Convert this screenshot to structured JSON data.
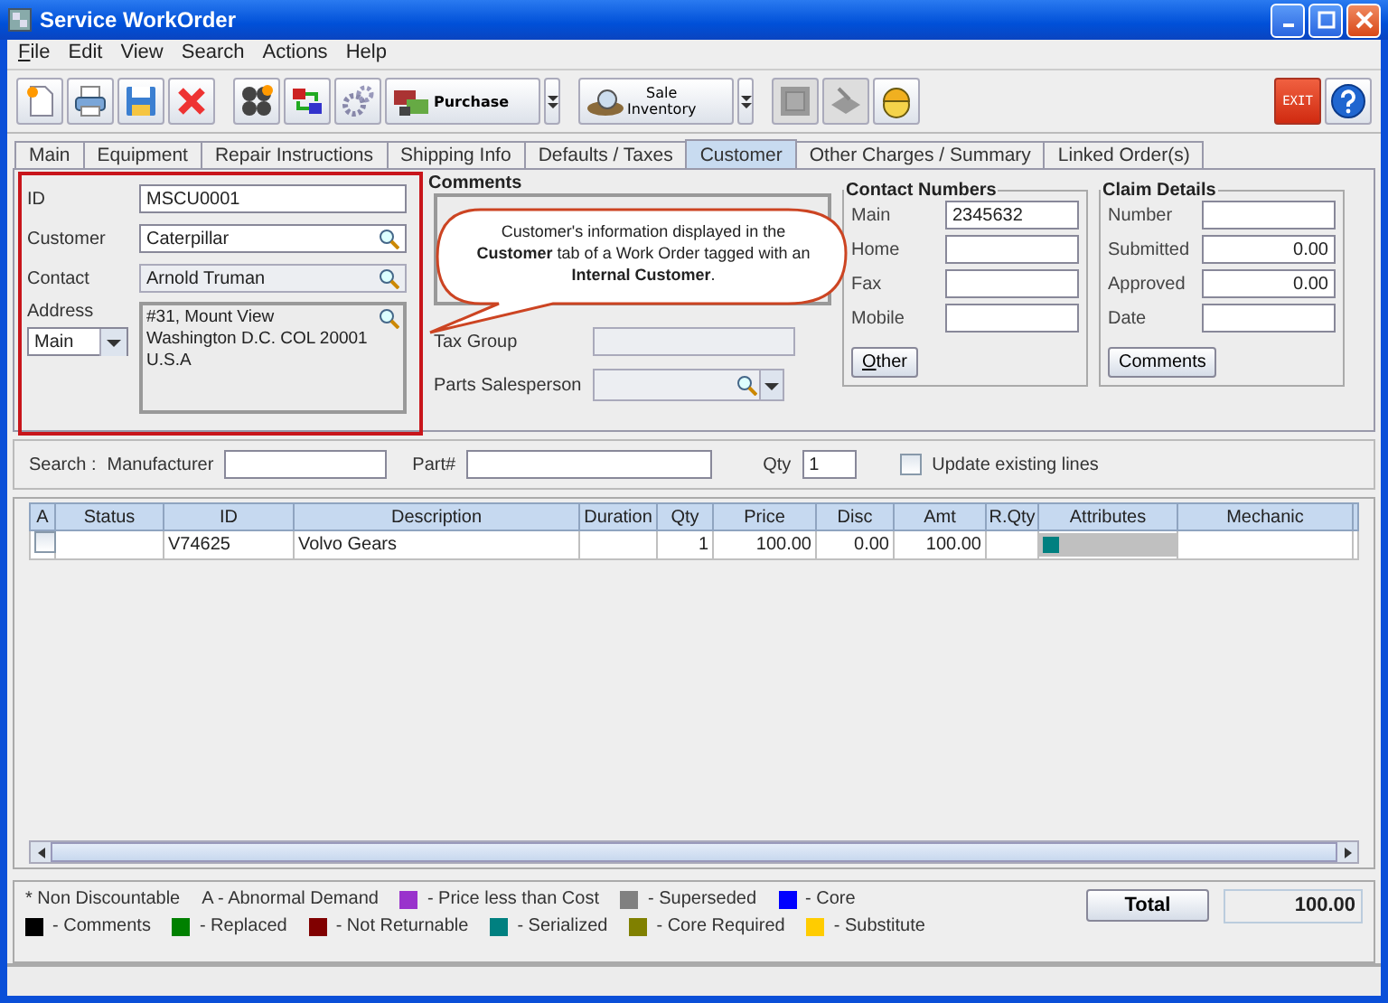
{
  "window": {
    "title": "Service WorkOrder"
  },
  "menu": [
    "File",
    "Edit",
    "View",
    "Search",
    "Actions",
    "Help"
  ],
  "toolbar": {
    "exit": "EXIT",
    "purchase": "Purchase",
    "sale_inventory": [
      "Sale",
      "Inventory"
    ]
  },
  "tabs": [
    {
      "label": "Main",
      "selected": false
    },
    {
      "label": "Equipment",
      "selected": false
    },
    {
      "label": "Repair Instructions",
      "selected": false
    },
    {
      "label": "Shipping Info",
      "selected": false
    },
    {
      "label": "Defaults / Taxes",
      "selected": false
    },
    {
      "label": "Customer",
      "selected": true
    },
    {
      "label": "Other Charges / Summary",
      "selected": false
    },
    {
      "label": "Linked Order(s)",
      "selected": false
    }
  ],
  "customer": {
    "id_label": "ID",
    "id": "MSCU0001",
    "customer_label": "Customer",
    "customer": "Caterpillar",
    "contact_label": "Contact",
    "contact": "Arnold Truman",
    "address_label": "Address",
    "address_type": "Main",
    "address": [
      "#31, Mount View",
      "Washington D.C. COL 20001",
      "U.S.A"
    ]
  },
  "comments": {
    "title": "Comments",
    "callout": "Customer's information displayed in the **Customer** tab of a Work Order tagged with an **Internal Customer**."
  },
  "tax_group": {
    "label": "Tax Group"
  },
  "parts_salesperson": {
    "label": "Parts Salesperson"
  },
  "contact_numbers": {
    "title": "Contact Numbers",
    "fields": [
      {
        "label": "Main",
        "value": "2345632"
      },
      {
        "label": "Home"
      },
      {
        "label": "Fax"
      },
      {
        "label": "Mobile"
      }
    ],
    "button": "Other"
  },
  "claim_details": {
    "title": "Claim Details",
    "fields": [
      {
        "label": "Number"
      },
      {
        "label": "Submitted",
        "value": "0.00"
      },
      {
        "label": "Approved",
        "value": "0.00"
      },
      {
        "label": "Date"
      }
    ],
    "button": "Comments"
  },
  "search": {
    "label": "Search :",
    "manufacturer_label": "Manufacturer",
    "part_label": "Part#",
    "qty_label": "Qty",
    "qty": "1",
    "update_label": "Update existing lines",
    "update_checked": false
  },
  "table": {
    "columns": [
      "A",
      "Status",
      "ID",
      "Description",
      "Duration",
      "Qty",
      "Price",
      "Disc",
      "Amt",
      "R.Qty",
      "Attributes",
      "Mechanic"
    ],
    "rows": [
      {
        "checked": false,
        "status": "",
        "id": "V74625",
        "description": "Volvo Gears",
        "duration": "",
        "qty": "1",
        "price": "100.00",
        "disc": "0.00",
        "amt": "100.00",
        "rqty": "",
        "color": "#008080",
        "mechanic": ""
      }
    ]
  },
  "legend": [
    {
      "text": "* Non Discountable"
    },
    {
      "text": "A - Abnormal Demand"
    },
    {
      "text": "- Price less than Cost",
      "color": "#9933cc"
    },
    {
      "text": "- Superseded",
      "color": "#808080"
    },
    {
      "text": "- Core",
      "color": "#0000ff"
    },
    {
      "text": "- Comments",
      "color": "#000000"
    },
    {
      "text": "- Replaced",
      "color": "#008000"
    },
    {
      "text": "- Not Returnable",
      "color": "#800000"
    },
    {
      "text": "- Serialized",
      "color": "#008080"
    },
    {
      "text": "- Core Required",
      "color": "#808000"
    },
    {
      "text": "- Substitute",
      "color": "#ffcc00"
    }
  ],
  "total": {
    "label": "Total",
    "value": "100.00"
  }
}
